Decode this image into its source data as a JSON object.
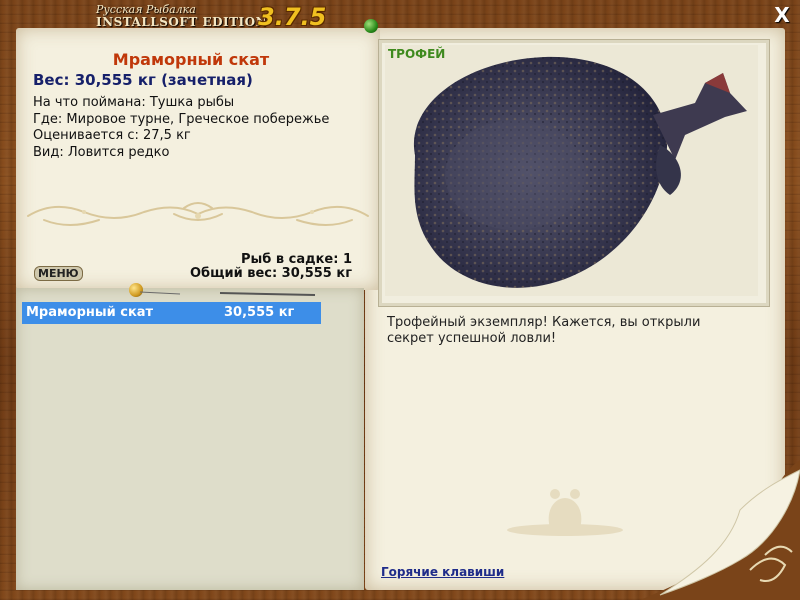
{
  "app": {
    "title_small": "Русская Рыбалка",
    "title_edition": "INSTALLSOFT EDITION",
    "version": "3.7.5",
    "close_label": "X"
  },
  "fish": {
    "name": "Мраморный скат",
    "weight_line": "Вес: 30,555 кг (зачетная)",
    "bait_line": "На что поймана: Тушка рыбы",
    "location_line": "Где: Мировое турне, Греческое побережье",
    "value_line": "Оценивается с: 27,5 кг",
    "kind_line": "Вид: Ловится редко"
  },
  "keepnet": {
    "count_line": "Рыб в садке: 1",
    "total_line": "Общий вес: 30,555 кг"
  },
  "menu_label": "МЕНЮ",
  "list": {
    "rows": [
      {
        "name": "Мраморный скат",
        "weight": "30,555 кг"
      }
    ]
  },
  "trophy": {
    "label": "ТРОФЕЙ",
    "message": "Трофейный экземпляр! Кажется, вы открыли секрет успешной ловли!"
  },
  "hotkeys_label": "Горячие клавиши",
  "colors": {
    "fish_name": "#c0380a",
    "weight": "#16206a",
    "selection": "#3d8ee8",
    "trophy": "#3f8a1e",
    "link": "#1f2c8a"
  }
}
